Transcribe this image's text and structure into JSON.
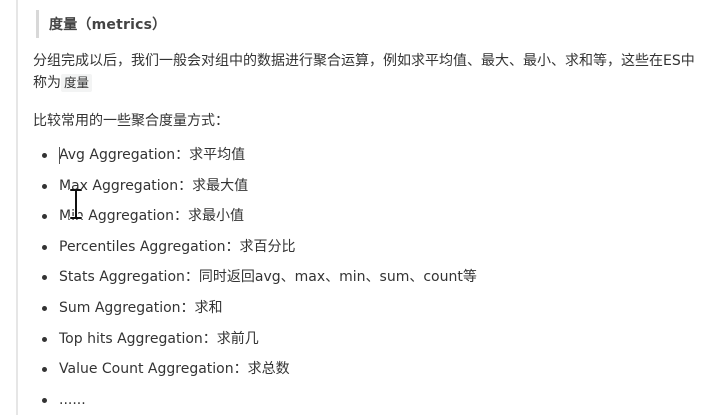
{
  "heading": "度量（metrics）",
  "intro": {
    "text": "分组完成以后，我们一般会对组中的数据进行聚合运算，例如求平均值、最大、最小、求和等，这些在ES中称为",
    "inline_code": "度量"
  },
  "list_intro": "比较常用的一些聚合度量方式：",
  "items": [
    {
      "label": "Avg Aggregation：求平均值"
    },
    {
      "label": "Max Aggregation：求最大值"
    },
    {
      "label": "Min Aggregation：求最小值"
    },
    {
      "label": "Percentiles Aggregation：求百分比"
    },
    {
      "label": "Stats Aggregation：同时返回avg、max、min、sum、count等"
    },
    {
      "label": "Sum Aggregation：求和"
    },
    {
      "label": "Top hits Aggregation：求前几"
    },
    {
      "label": "Value Count Aggregation：求总数"
    },
    {
      "label": "......"
    }
  ]
}
